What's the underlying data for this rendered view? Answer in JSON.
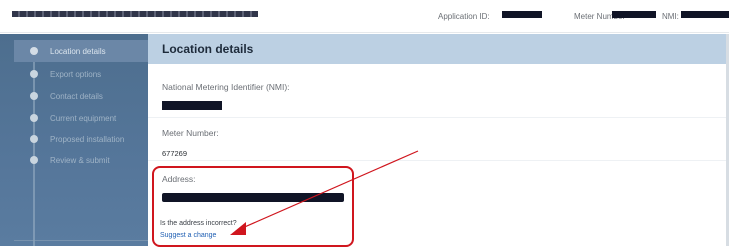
{
  "header": {
    "application_label": "Application ID:",
    "meter_label": "Meter Number",
    "nmi_label": "NMI:"
  },
  "sidebar": {
    "items": [
      {
        "label": "Location details",
        "active": true
      },
      {
        "label": "Export options",
        "active": false
      },
      {
        "label": "Contact details",
        "active": false
      },
      {
        "label": "Current equipment",
        "active": false
      },
      {
        "label": "Proposed installation",
        "active": false
      },
      {
        "label": "Review & submit",
        "active": false
      }
    ]
  },
  "main": {
    "title": "Location details",
    "nmi_label": "National Metering Identifier (NMI):",
    "meter_label": "Meter Number:",
    "meter_value": "677269",
    "address_label": "Address:",
    "incorrect_text": "Is the address incorrect?",
    "suggest_link": "Suggest a change"
  },
  "colors": {
    "sidebar": "#55769a",
    "header_band": "#bcd0e3",
    "highlight": "#d0161e",
    "link": "#1f5fb3"
  }
}
